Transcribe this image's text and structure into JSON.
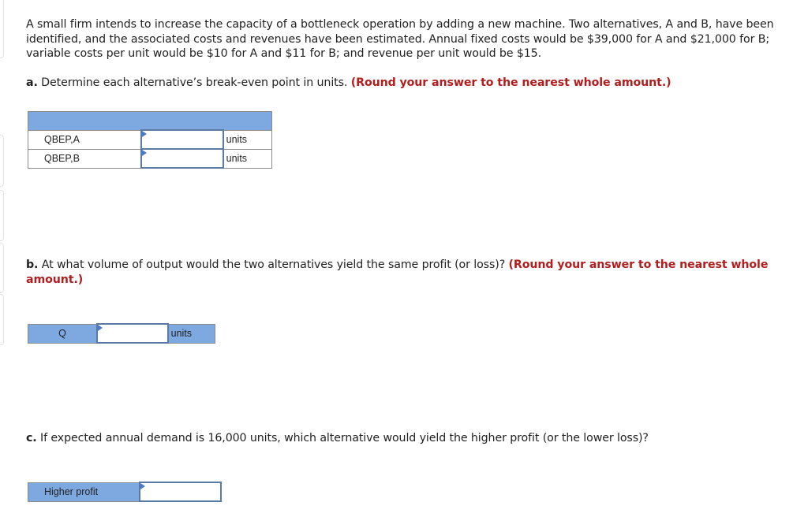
{
  "problem": {
    "intro": "A small firm intends to increase the capacity of a bottleneck operation by adding a new machine. Two alternatives, A and B, have been identified, and the associated costs and revenues have been estimated. Annual fixed costs would be $39,000 for A and $21,000 for B; variable costs per unit would be $10 for A and $11 for B; and revenue per unit would be $15."
  },
  "part_a": {
    "letter": "a.",
    "question": " Determine each alternative’s break-even point in units. ",
    "hint": "(Round your answer to the nearest whole amount.)",
    "rows": [
      {
        "label": "QBEP,A",
        "value": "",
        "unit": "units"
      },
      {
        "label": "QBEP,B",
        "value": "",
        "unit": "units"
      }
    ]
  },
  "part_b": {
    "letter": "b.",
    "question": " At what volume of output would the two alternatives yield the same profit (or loss)? ",
    "hint": "(Round your answer to the nearest whole amount.)",
    "label": "Q",
    "value": "",
    "unit": "units"
  },
  "part_c": {
    "letter": "c.",
    "question": " If expected annual demand is 16,000 units, which alternative would yield the higher profit (or the lower loss)?",
    "label": "Higher profit",
    "value": ""
  },
  "colors": {
    "header_blue": "#7ea8e0",
    "hint_red": "#b01e1e",
    "input_border": "#5b7aa3"
  }
}
